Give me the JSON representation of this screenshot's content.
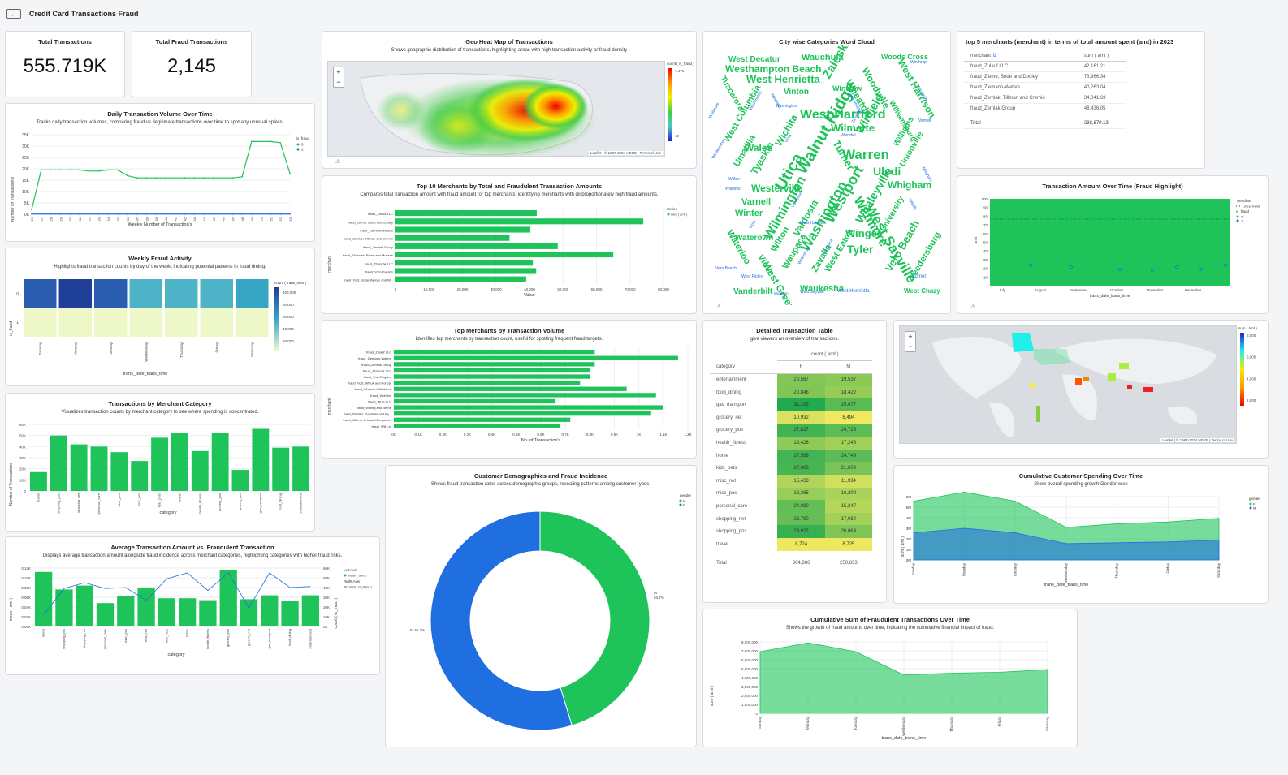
{
  "app": {
    "title": "Credit Card Transactions Fraud"
  },
  "kpis": [
    {
      "label": "Total Transactions",
      "value": "555.719K"
    },
    {
      "label": "Total Fraud Transactions",
      "value": "2,145"
    }
  ],
  "daily": {
    "title": "Daily Transaction Volume Over Time",
    "subtitle": "Tracks daily transaction volumes, comparing fraud vs. legitimate transactions over time to spot any unusual spikes.",
    "xlabel": "Weekly Number of Transaction's",
    "ylabel": "Number Of Transaction's",
    "legend_title": "is_fraud",
    "legend": [
      "0",
      "1"
    ],
    "chart_data": {
      "type": "line",
      "x": [
        "26",
        "27",
        "28",
        "29",
        "30",
        "31",
        "32",
        "33",
        "34",
        "35",
        "36",
        "37",
        "38",
        "39",
        "40",
        "41",
        "42",
        "43",
        "44",
        "45",
        "46",
        "47",
        "48",
        "49",
        "50",
        "51",
        "52",
        "53"
      ],
      "yticks": [
        "0K",
        "5K",
        "10K",
        "15K",
        "20K",
        "25K",
        "30K",
        "35K"
      ],
      "series": [
        {
          "name": "0",
          "color": "#1ec45a",
          "values": [
            2,
            19.5,
            19.5,
            19.5,
            19.5,
            19.5,
            19,
            19,
            19.5,
            19.5,
            17,
            16,
            16,
            16,
            16,
            16,
            16,
            16,
            16,
            16,
            16,
            16,
            16.5,
            32,
            32,
            32,
            31.5,
            18
          ]
        },
        {
          "name": "1",
          "color": "#1f6fe0",
          "values": [
            0.1,
            0.1,
            0.1,
            0.1,
            0.1,
            0.1,
            0.1,
            0.1,
            0.1,
            0.1,
            0.1,
            0.1,
            0.1,
            0.1,
            0.1,
            0.1,
            0.1,
            0.1,
            0.1,
            0.1,
            0.1,
            0.1,
            0.1,
            0.1,
            0.1,
            0.1,
            0.1,
            0.1
          ]
        }
      ],
      "ylim": [
        0,
        35
      ]
    }
  },
  "weekly": {
    "title": "Weekly Fraud Activity",
    "subtitle": "Highlights fraud transaction counts by day of the week, indicating potential patterns in fraud timing.",
    "xlabel": "trans_date_trans_time",
    "ylabel": "is_fraud",
    "rows": [
      "0",
      "1"
    ],
    "days": [
      "Sunday",
      "Monday",
      "Tuesday",
      "Wednesday",
      "Thursday",
      "Friday",
      "Saturday"
    ],
    "legend_title": "count ( trans_num )",
    "legend_ticks": [
      "100,000",
      "80,000",
      "60,000",
      "40,000",
      "20,000"
    ],
    "chart_data": {
      "type": "heatmap",
      "colors": [
        [
          "#2a5db0",
          "#1f3f98",
          "#2a5db0",
          "#4fb3c8",
          "#4fb3c8",
          "#4fb3c8",
          "#37a6c4"
        ],
        [
          "#eef7c8",
          "#eef7c8",
          "#eef7c8",
          "#eef7c8",
          "#eef7c8",
          "#eef7c8",
          "#eef7c8"
        ]
      ]
    }
  },
  "category": {
    "title": "Transactions by Merchant Category",
    "subtitle": "Visualizes transaction counts by merchant category to see where spending is concentrated.",
    "xlabel": "category",
    "ylabel": "Number of Transactions",
    "yticks": [
      "0",
      "10K",
      "20K",
      "30K",
      "40K",
      "50K",
      "60K"
    ],
    "chart_data": {
      "type": "bar",
      "categories": [
        "travel",
        "shopping_pos",
        "shopping_net",
        "personal_care",
        "misc_pos",
        "misc_net",
        "kids_pets",
        "home",
        "health_fitness",
        "grocery_pos",
        "grocery_net",
        "gas_transport",
        "food_dining",
        "entertainment"
      ],
      "values": [
        17,
        50,
        42,
        40,
        35,
        27,
        48,
        52,
        36,
        52,
        19,
        56,
        39,
        40
      ],
      "ylim": [
        0,
        60
      ]
    }
  },
  "avg": {
    "title": "Average Transaction Amount vs. Fraudulent Transaction",
    "subtitle": "Displays average transaction amount alongside fraud incidence across merchant categories, highlighting categories with higher fraud risks.",
    "xlabel": "category",
    "ylabel_left": "mean ( amt )",
    "ylabel_right": "count ( is_fraud )",
    "legend": {
      "left_title": "Left Axis",
      "left_item": "mean ( amt )",
      "right_title": "Right Axis",
      "right_item": "count ( is_fraud )"
    },
    "yticks_left": [
      "0.00K",
      "0.02K",
      "0.04K",
      "0.06K",
      "0.08K",
      "0.10K",
      "0.12K"
    ],
    "yticks_right": [
      "0K",
      "10K",
      "20K",
      "30K",
      "40K",
      "50K",
      "60K"
    ],
    "chart_data": {
      "type": "bar",
      "categories": [
        "travel",
        "shopping_pos",
        "shopping_net",
        "personal_care",
        "misc_pos",
        "misc_net",
        "kids_pets",
        "home",
        "health_fitness",
        "grocery_pos",
        "grocery_net",
        "gas_transport",
        "food_dining",
        "entertainment"
      ],
      "values": [
        0.112,
        0.076,
        0.084,
        0.048,
        0.062,
        0.08,
        0.058,
        0.058,
        0.054,
        0.115,
        0.056,
        0.064,
        0.052,
        0.064
      ],
      "line": [
        12,
        39,
        45,
        39,
        40,
        27,
        49,
        55,
        37,
        55,
        19,
        55,
        40,
        41
      ],
      "ylim": [
        0,
        0.12
      ]
    }
  },
  "geo": {
    "title": "Geo Heat Map of Transactions",
    "subtitle": "Shows geographic distribution of transactions, highlighting areas with high transaction activity or fraud density",
    "legend_title": "count ( is_fraud )",
    "legend_max": "1,471",
    "legend_min": "12",
    "attribution": "Leaflet | © 1987-2024 HERE | Terms of Use",
    "places": [
      "Portland",
      "Seattle",
      "Salt Lake City",
      "San Francisco",
      "Los Angeles",
      "Phoenix",
      "Denver",
      "UNITED STATES OF AMERICA",
      "Dallas",
      "Houston",
      "Chicago",
      "New York",
      "Miami",
      "Monterrey",
      "Havana",
      "Mexico"
    ]
  },
  "top10": {
    "title": "Top 10 Merchants by Total and Fraudulent Transaction Amounts",
    "subtitle": "Compares total transaction amount with fraud amount for top merchants, identifying merchants with disproportionately high fraud amounts.",
    "ylabel": "merchant",
    "xlabel": "Value",
    "legend_title": "Series",
    "legend_item": "sum ( amt )",
    "xticks": [
      "0",
      "10,000",
      "20,000",
      "30,000",
      "40,000",
      "50,000",
      "60,000",
      "70,000",
      "80,000"
    ],
    "chart_data": {
      "type": "bar",
      "categories": [
        "fraud_Zulauf LLC",
        "fraud_Zieme, Bode and Dooley",
        "fraud_Ziemann-Waters",
        "fraud_Zemlak, Tillman and Cremin",
        "fraud_Zemlak Group",
        "fraud_Zboncak, Rowe and Murazik",
        "fraud_Zboncak LLC",
        "fraud_Yost-Rogahn",
        "fraud_Yost, Schamberger and W..."
      ],
      "values": [
        42161,
        73966,
        40263,
        34042,
        48436,
        65000,
        41000,
        42000,
        39000
      ],
      "xlim": [
        0,
        80000
      ]
    }
  },
  "volume": {
    "title": "Top Merchants by Transaction Volume",
    "subtitle": "Identifies top merchants by transaction count, useful for spotting frequent fraud targets.",
    "ylabel": "merchant",
    "xlabel": "No. of Transaction's",
    "xticks": [
      "0K",
      "0.1K",
      "0.2K",
      "0.3K",
      "0.4K",
      "0.5K",
      "0.6K",
      "0.7K",
      "0.8K",
      "0.9K",
      "1K",
      "1.1K",
      "1.2K"
    ],
    "chart_data": {
      "type": "bar",
      "categories": [
        "fraud_Zulauf LLC",
        "fraud_Ziemann-Waters",
        "fraud_Zemlak Group",
        "fraud_Zboncak LLC",
        "fraud_Yost-Rogahn",
        "fraud_Yost, Wisok and Konopi",
        "fraud_Wunsch-Wiklobson",
        "fraud_Wolf Inc",
        "fraud_Wiza LLC",
        "fraud_Witting and Berne",
        "fraud_Windler, Goodwin and Ky...",
        "fraud_Willms, Kris and Bergnaum",
        "fraud_Will Ltd"
      ],
      "values": [
        0.82,
        1.16,
        0.82,
        0.8,
        0.8,
        0.76,
        0.95,
        1.07,
        0.66,
        1.1,
        1.05,
        0.72,
        0.68
      ],
      "xlim": [
        0,
        1.2
      ]
    }
  },
  "demo": {
    "title": "Customer Demographics and Fraud Incidence",
    "subtitle": "Shows fraud transaction rates across demographic groups, revealing patterns among customer types.",
    "legend_title": "gender",
    "legend": [
      "M",
      "F"
    ],
    "label_m": "M",
    "label_m_pct": "54.7%",
    "label_f": "F: 45.3%",
    "chart_data": {
      "type": "pie",
      "categories": [
        "M",
        "F"
      ],
      "values": [
        45.3,
        54.7
      ]
    }
  },
  "wordcloud": {
    "title": "City wise Categories Word Cloud"
  },
  "table": {
    "title": "Detailed Transaction Table",
    "subtitle": "give viewers an overview of transactions.",
    "col_group": "count ( amt )",
    "cols": [
      "category",
      "F",
      "M"
    ],
    "rows": [
      [
        "entertainment",
        "20,587",
        "19,537"
      ],
      [
        "food_dining",
        "20,846",
        "18,422"
      ],
      [
        "gas_transport",
        "31,293",
        "25,077"
      ],
      [
        "grocery_net",
        "10,932",
        "8,494"
      ],
      [
        "grocery_pos",
        "27,827",
        "24,726"
      ],
      [
        "health_fitness",
        "19,428",
        "17,246"
      ],
      [
        "home",
        "27,596",
        "24,749"
      ],
      [
        "kids_pets",
        "27,083",
        "21,609"
      ],
      [
        "misc_net",
        "15,433",
        "11,934"
      ],
      [
        "misc_pos",
        "18,365",
        "16,209"
      ],
      [
        "personal_care",
        "24,080",
        "15,247"
      ],
      [
        "shopping_net",
        "23,790",
        "17,080"
      ],
      [
        "shopping_pos",
        "28,922",
        "20,869"
      ],
      [
        "travel",
        "8,724",
        "8,725"
      ]
    ],
    "total": [
      "Total",
      "304,886",
      "250,833"
    ]
  },
  "cumfraud": {
    "title": "Cumulative Sum of Fraudulent Transactions Over Time",
    "subtitle": "Shows the growth of fraud amounts over time, indicating the cumulative financial impact of fraud.",
    "xlabel": "trans_date_trans_time",
    "ylabel": "sum ( amt )",
    "yticks": [
      "0",
      "1,000,000",
      "2,000,000",
      "3,000,000",
      "4,000,000",
      "5,000,000",
      "6,000,000",
      "7,000,000",
      "8,000,000"
    ],
    "chart_data": {
      "type": "area",
      "categories": [
        "Sunday",
        "Monday",
        "Tuesday",
        "Wednesday",
        "Thursday",
        "Friday",
        "Saturday"
      ],
      "values": [
        6900000,
        7900000,
        6900000,
        4300000,
        4500000,
        4600000,
        4900000
      ],
      "ylim": [
        0,
        8000000
      ]
    }
  },
  "top5": {
    "title": "top 5 merchants (merchant) in terms of total amount spent (amt) in 2023",
    "cols": [
      "merchant",
      "sum ( amt )"
    ],
    "rows": [
      [
        "fraud_Zulauf LLC",
        "42,161.21"
      ],
      [
        "fraud_Zieme, Bode and Dooley",
        "73,966.34"
      ],
      [
        "fraud_Ziemann-Waters",
        "40,263.04"
      ],
      [
        "fraud_Zemlak, Tillman and Cremin",
        "34,041.69"
      ],
      [
        "fraud_Zemlak Group",
        "48,436.05"
      ]
    ],
    "total": [
      "Total",
      "238,870.13"
    ]
  },
  "amtTime": {
    "title": "Transaction Amount Over Time (Fraud Highlight)",
    "ylabel": "amt",
    "xlabel": "trans_date_trans_time",
    "legend_title": "Trendline",
    "legend_sub": "Linear trend",
    "legend_fraud": "is_fraud",
    "legend": [
      "0",
      "1"
    ],
    "months": [
      "July",
      "August",
      "September",
      "October",
      "November",
      "December"
    ],
    "yticks": [
      "10",
      "20",
      "30",
      "40",
      "50",
      "60",
      "70",
      "80",
      "90",
      "100"
    ]
  },
  "world": {
    "attribution": "Leaflet | © 1987-2024 HERE | Terms of Use",
    "legend_title": "sum ( amt )",
    "legend_ticks": [
      "8,000",
      "6,000",
      "4,000",
      "2,000"
    ],
    "places": [
      "North Pacific Ocean",
      "North Atlantic Ocean",
      "South Pacific Ocean",
      "South Atlantic Ocean",
      "Indian Ocean",
      "Southern Ocean",
      "AFRICA",
      "ASIA",
      "EUROPE"
    ]
  },
  "cumcust": {
    "title": "Cumulative Customer Spending Over Time",
    "subtitle": "Show overall spending growth Gender wise",
    "xlabel": "trans_date_trans_time",
    "ylabel": "sum ( amt )",
    "legend_title": "gender",
    "legend": [
      "F",
      "M"
    ],
    "yticks": [
      "0M",
      "1M",
      "2M",
      "3M",
      "4M",
      "5M",
      "6M"
    ],
    "chart_data": {
      "type": "area",
      "categories": [
        "Sunday",
        "Monday",
        "Tuesday",
        "Wednesday",
        "Thursday",
        "Friday",
        "Saturday"
      ],
      "series": [
        {
          "name": "F",
          "values": [
            6.5,
            7.5,
            6.5,
            3.6,
            4,
            4.2,
            4.6
          ]
        },
        {
          "name": "M",
          "values": [
            3,
            3.5,
            3,
            1.8,
            1.9,
            2,
            2.2
          ]
        }
      ],
      "ylim": [
        0,
        7
      ]
    }
  },
  "colors": {
    "green": "#1ec45a",
    "blue": "#1f6fe0"
  }
}
